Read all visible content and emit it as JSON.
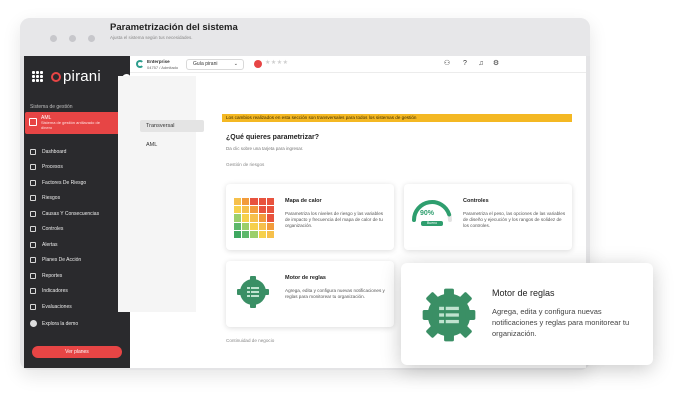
{
  "sidebar": {
    "logo_text": "pirani",
    "section_label": "Sistema de gestión",
    "active_system": {
      "title": "AML",
      "subtitle": "Sistema de gestión antilavado de dinero"
    },
    "items": [
      {
        "label": "Dashboard"
      },
      {
        "label": "Procesos"
      },
      {
        "label": "Factores De Riesgo"
      },
      {
        "label": "Riesgos"
      },
      {
        "label": "Causas Y Consecuencias"
      },
      {
        "label": "Controles"
      },
      {
        "label": "Alertas"
      },
      {
        "label": "Planes De Acción"
      },
      {
        "label": "Reportes"
      },
      {
        "label": "Indicadores"
      },
      {
        "label": "Evaluaciones"
      }
    ],
    "explore_label": "Explora la demo",
    "plans_button": "Ver planes"
  },
  "topbar": {
    "plan_name": "Enterprise",
    "plan_status": "04757 / Admitado",
    "guide_label": "Guía pirani",
    "rating_stars": "★★★★",
    "icons": [
      "add-user-icon",
      "help-icon",
      "bell-icon",
      "gear-icon",
      "chevron-down-icon"
    ]
  },
  "page": {
    "title": "Parametrización del sistema",
    "subtitle": "Ajusta el sistema según tus necesidades."
  },
  "tabs": [
    {
      "label": "Transversal",
      "active": true
    },
    {
      "label": "AML",
      "active": false
    }
  ],
  "banner": "Los cambios realizados en esta sección son transversales para todos los sistemas de gestión",
  "question": {
    "title": "¿Qué quieres parametrizar?",
    "subtitle": "Da clic sobre una tarjeta para ingresar."
  },
  "groups": {
    "risk_management": "Gestión de riesgos",
    "business_continuity": "Continuidad de negocio"
  },
  "cards": {
    "heatmap": {
      "title": "Mapa de calor",
      "description": "Parametriza los niveles de riesgo y las variables de impacto y frecuencia del mapa de calor de tu organización."
    },
    "controls": {
      "title": "Controles",
      "gauge_value": "90%",
      "gauge_fraction": 0.9,
      "gauge_badge": "Bueno",
      "description": "Parametriza el peso, las opciones de las variables de diseño y ejecución y los rangos de solidez de los controles."
    },
    "rules": {
      "title": "Motor de reglas",
      "description": "Agrega, edita y configura nuevas notificaciones y reglas para monitorear tu organización."
    },
    "rules_zoom": {
      "title": "Motor de reglas",
      "description": "Agrega, edita y configura nuevas notificaciones y reglas para monitorear tu organización."
    }
  },
  "colors": {
    "brand_red": "#e74545",
    "sidebar_bg": "#2a2a2d",
    "banner_yellow": "#f4b823",
    "accent_green": "#2e9e6e"
  }
}
